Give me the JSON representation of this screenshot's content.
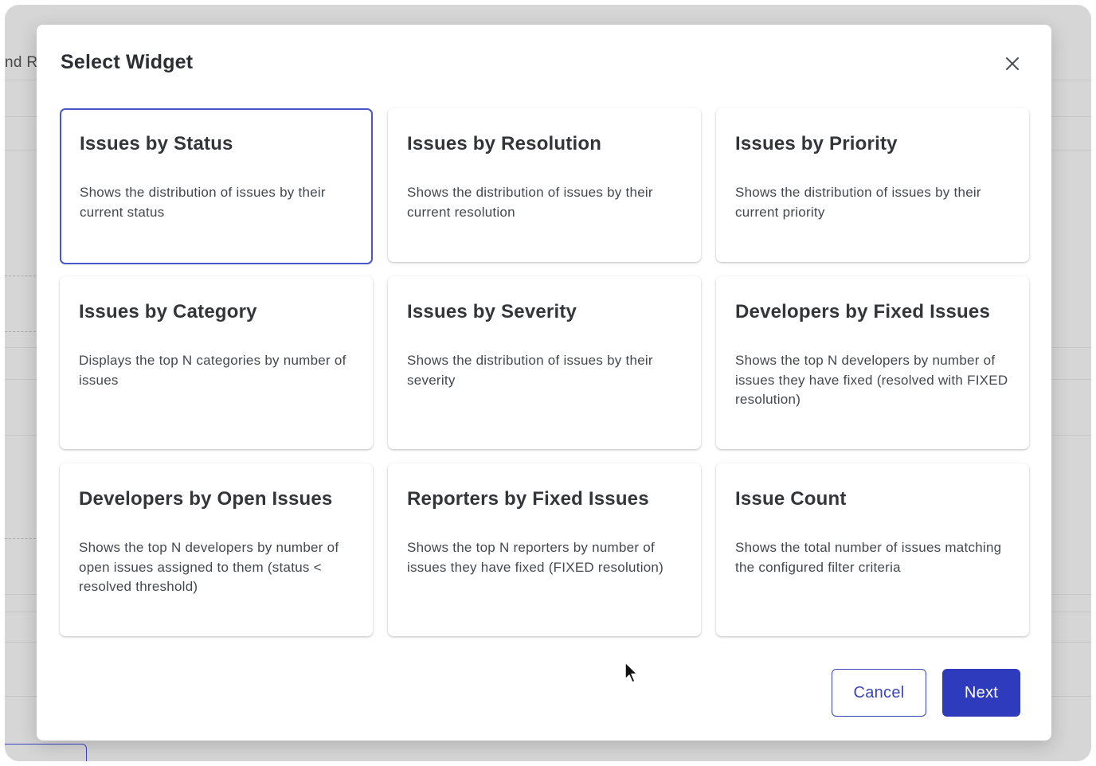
{
  "background": {
    "partial_text": "nd R"
  },
  "dialog": {
    "title": "Select Widget",
    "close_icon": "close-icon",
    "widgets": [
      {
        "title": "Issues by Status",
        "description": "Shows the distribution of issues by their current status",
        "selected": true
      },
      {
        "title": "Issues by Resolution",
        "description": "Shows the distribution of issues by their current resolution",
        "selected": false
      },
      {
        "title": "Issues by Priority",
        "description": "Shows the distribution of issues by their current priority",
        "selected": false
      },
      {
        "title": "Issues by Category",
        "description": "Displays the top N categories by number of issues",
        "selected": false
      },
      {
        "title": "Issues by Severity",
        "description": "Shows the distribution of issues by their severity",
        "selected": false
      },
      {
        "title": "Developers by Fixed Issues",
        "description": "Shows the top N developers by number of issues they have fixed (resolved with FIXED resolution)",
        "selected": false
      },
      {
        "title": "Developers by Open Issues",
        "description": "Shows the top N developers by number of open issues assigned to them (status < resolved threshold)",
        "selected": false
      },
      {
        "title": "Reporters by Fixed Issues",
        "description": "Shows the top N reporters by number of issues they have fixed (FIXED resolution)",
        "selected": false
      },
      {
        "title": "Issue Count",
        "description": "Shows the total number of issues matching the configured filter criteria",
        "selected": false
      }
    ],
    "cancel_label": "Cancel",
    "next_label": "Next"
  },
  "colors": {
    "accent": "#2f3bbd",
    "selected_border": "#4a57c8",
    "overlay": "#d6d6d6"
  }
}
